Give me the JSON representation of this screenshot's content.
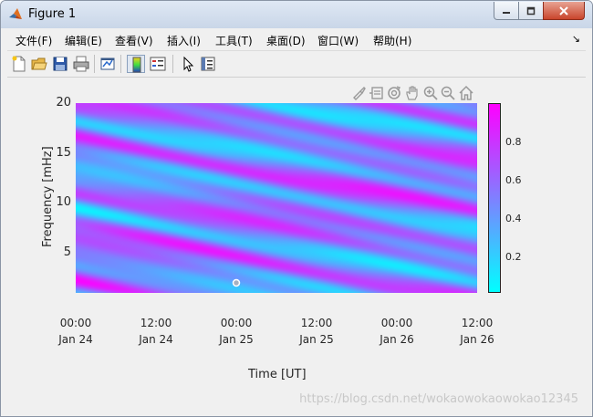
{
  "window": {
    "title": "Figure 1",
    "watermark": "https://blog.csdn.net/wokaowokaowokao12345"
  },
  "menu": {
    "items": [
      "文件(F)",
      "编辑(E)",
      "查看(V)",
      "插入(I)",
      "工具(T)",
      "桌面(D)",
      "窗口(W)",
      "帮助(H)"
    ],
    "overflow_glyph": "↘"
  },
  "toolbar": {
    "buttons": [
      "new-figure-icon",
      "open-folder-icon",
      "save-icon",
      "print-icon",
      "link-plot-icon",
      "colorbar-icon",
      "legend-icon",
      "pointer-icon",
      "property-editor-icon"
    ]
  },
  "axes_toolbar": {
    "buttons": [
      "brush-icon",
      "data-cursor-icon",
      "rotate-3d-icon",
      "pan-icon",
      "zoom-in-icon",
      "zoom-out-icon",
      "home-icon"
    ]
  },
  "chart_data": {
    "type": "heatmap",
    "xlabel": "Time [UT]",
    "ylabel": "Frequency [mHz]",
    "x_ticks": [
      {
        "time": "00:00",
        "date": "Jan 24"
      },
      {
        "time": "12:00",
        "date": "Jan 24"
      },
      {
        "time": "00:00",
        "date": "Jan 25"
      },
      {
        "time": "12:00",
        "date": "Jan 25"
      },
      {
        "time": "00:00",
        "date": "Jan 26"
      },
      {
        "time": "12:00",
        "date": "Jan 26"
      }
    ],
    "y_ticks": [
      20,
      15,
      10,
      5
    ],
    "ylim": [
      1,
      20
    ],
    "colormap": "cool",
    "colormap_colors": [
      "#00ffff",
      "#ff00ff"
    ],
    "colorbar": {
      "ticks": [
        0.8,
        0.6,
        0.4,
        0.2
      ],
      "range": [
        0,
        0.95
      ]
    },
    "marker_point": {
      "x": "Jan 25 00:00",
      "y": 2
    }
  }
}
